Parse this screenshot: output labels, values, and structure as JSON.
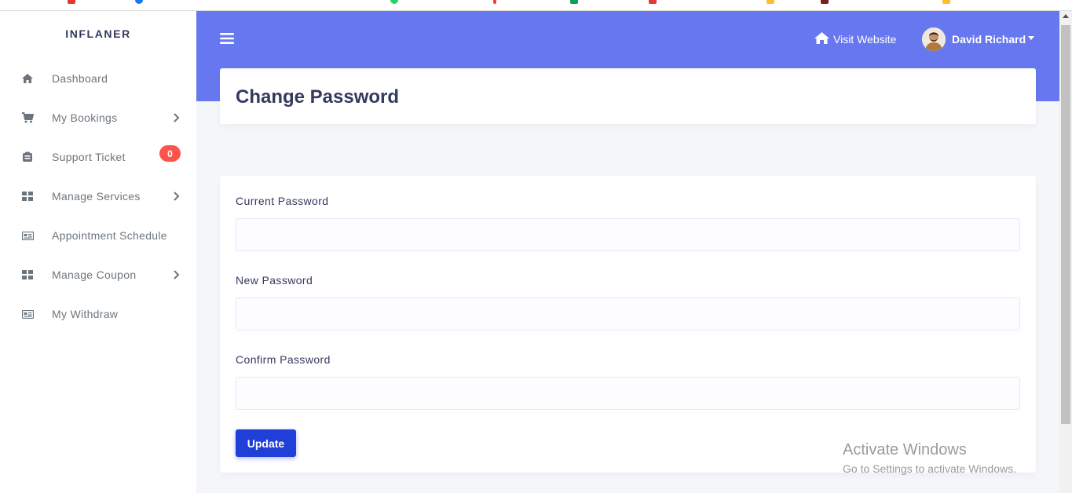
{
  "sidebar": {
    "brand": "INFLANER",
    "items": [
      {
        "label": "Dashboard",
        "icon": "home-icon"
      },
      {
        "label": "My Bookings",
        "icon": "cart-icon",
        "has_submenu": true
      },
      {
        "label": "Support Ticket",
        "icon": "ticket-icon",
        "badge": "0"
      },
      {
        "label": "Manage Services",
        "icon": "grid-icon",
        "has_submenu": true
      },
      {
        "label": "Appointment Schedule",
        "icon": "schedule-icon"
      },
      {
        "label": "Manage Coupon",
        "icon": "grid-icon",
        "has_submenu": true
      },
      {
        "label": "My Withdraw",
        "icon": "withdraw-icon"
      }
    ]
  },
  "header": {
    "visit_website": "Visit Website",
    "user_name": "David Richard"
  },
  "page": {
    "title": "Change Password"
  },
  "form": {
    "current_password_label": "Current Password",
    "current_password_value": "",
    "new_password_label": "New Password",
    "new_password_value": "",
    "confirm_password_label": "Confirm Password",
    "confirm_password_value": "",
    "submit_label": "Update"
  },
  "watermark": {
    "line1": "Activate Windows",
    "line2": "Go to Settings to activate Windows."
  },
  "colors": {
    "primary": "#6777ef",
    "button": "#1f3fd8",
    "badge": "#fc544b",
    "sidebar_text": "#6c757d",
    "heading": "#34395e"
  }
}
